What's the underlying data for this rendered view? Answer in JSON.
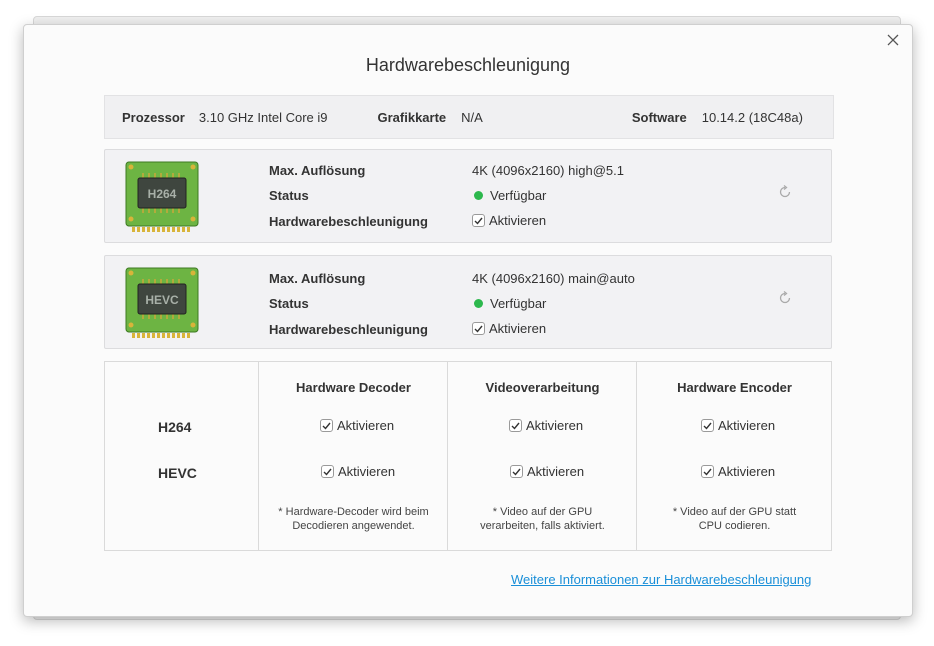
{
  "dialog": {
    "title": "Hardwarebeschleunigung"
  },
  "info": {
    "processor_label": "Prozessor",
    "processor_value": "3.10 GHz Intel Core i9",
    "gpu_label": "Grafikkarte",
    "gpu_value": "N/A",
    "software_label": "Software",
    "software_value": "10.14.2 (18C48a)"
  },
  "codecs": [
    {
      "chip": "H264",
      "res_label": "Max. Auflösung",
      "res_value": "4K (4096x2160) high@5.1",
      "status_label": "Status",
      "status_value": "Verfügbar",
      "hw_label": "Hardwarebeschleunigung",
      "hw_checkbox": "Aktivieren",
      "hw_checked": true
    },
    {
      "chip": "HEVC",
      "res_label": "Max. Auflösung",
      "res_value": "4K (4096x2160) main@auto",
      "status_label": "Status",
      "status_value": "Verfügbar",
      "hw_label": "Hardwarebeschleunigung",
      "hw_checkbox": "Aktivieren",
      "hw_checked": true
    }
  ],
  "matrix": {
    "columns": [
      "Hardware Decoder",
      "Videoverarbeitung",
      "Hardware Encoder"
    ],
    "rows": [
      "H264",
      "HEVC"
    ],
    "checkbox_label": "Aktivieren",
    "notes": [
      [
        "* Hardware-Decoder wird beim",
        "Decodieren angewendet."
      ],
      [
        "* Video auf der GPU",
        "verarbeiten, falls aktiviert."
      ],
      [
        "* Video auf der GPU statt",
        "CPU codieren."
      ]
    ]
  },
  "link": {
    "text": "Weitere Informationen zur Hardwarebeschleunigung"
  },
  "colors": {
    "status_ok": "#2db84d",
    "link": "#1a8fd8",
    "chip_green": "#5fae3a"
  }
}
